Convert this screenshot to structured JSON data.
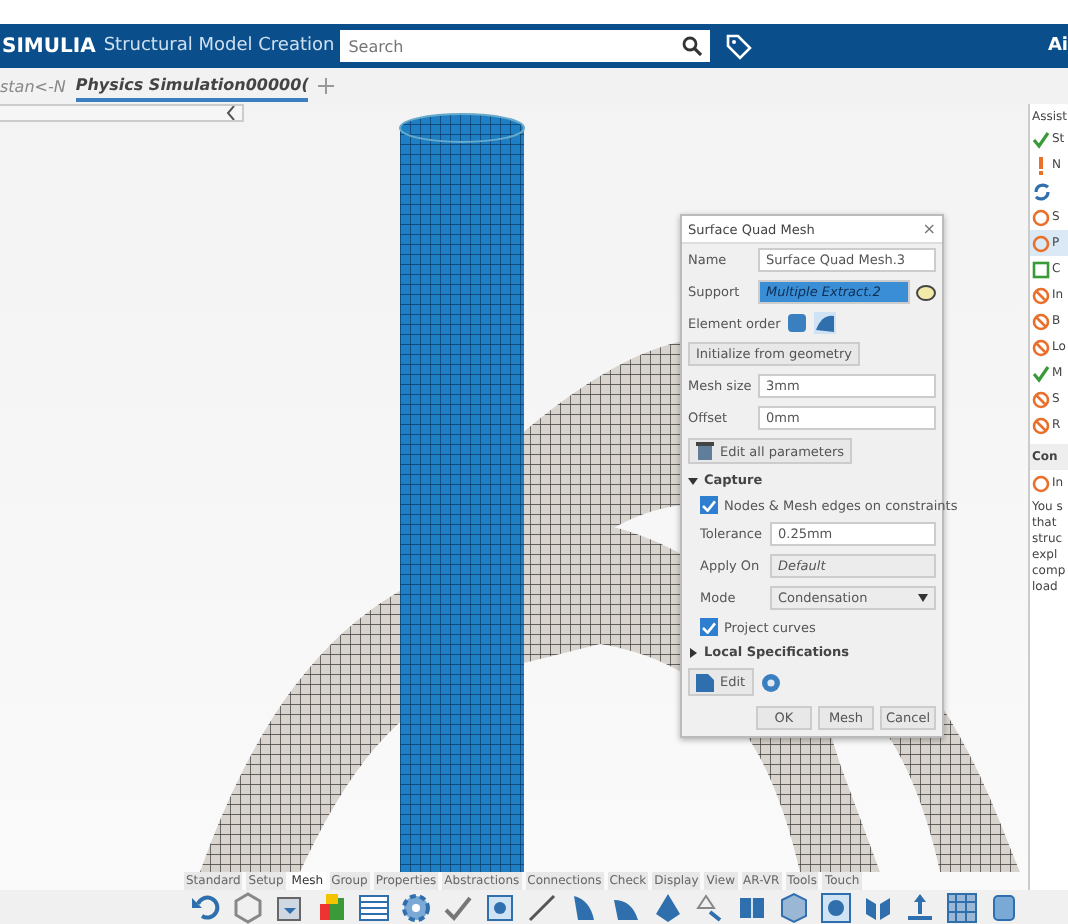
{
  "header": {
    "brand": "SIMULIA",
    "app_title": "Structural Model Creation",
    "search": {
      "placeholder": "Search"
    },
    "user_initials": "Ai"
  },
  "tabs": [
    {
      "label": "stan<-N",
      "selected": false
    },
    {
      "label": "Physics Simulation00000(",
      "selected": true
    }
  ],
  "dialog": {
    "title": "Surface Quad Mesh",
    "close": "×",
    "name_label": "Name",
    "name_value": "Surface Quad Mesh.3",
    "support_label": "Support",
    "support_value": "Multiple Extract.2",
    "element_order_label": "Element order",
    "init_button": "Initialize from geometry",
    "mesh_size_label": "Mesh size",
    "mesh_size_value": "3mm",
    "offset_label": "Offset",
    "offset_value": "0mm",
    "edit_all_button": "Edit all parameters",
    "capture": {
      "title": "Capture",
      "expanded": true,
      "nodes_label": "Nodes & Mesh edges on constraints",
      "nodes_checked": true,
      "tolerance_label": "Tolerance",
      "tolerance_value": "0.25mm",
      "apply_on_label": "Apply On",
      "apply_on_value": "Default",
      "mode_label": "Mode",
      "mode_value": "Condensation",
      "project_label": "Project curves",
      "project_checked": true
    },
    "local_specs": {
      "title": "Local Specifications",
      "expanded": false
    },
    "edit_button": "Edit",
    "buttons": [
      "OK",
      "Mesh",
      "Cancel"
    ]
  },
  "assistant": {
    "title": "Assist",
    "items": [
      {
        "kind": "done",
        "label": "St",
        "selected": false
      },
      {
        "kind": "warning",
        "label": "N",
        "selected": false
      },
      {
        "kind": "refresh",
        "selected": false
      },
      {
        "kind": "todo",
        "label": "S",
        "selected": false
      },
      {
        "kind": "todo",
        "label": "P",
        "selected": true
      },
      {
        "kind": "square",
        "label": "C",
        "selected": false
      },
      {
        "kind": "blocked",
        "label": "In",
        "selected": false
      },
      {
        "kind": "blocked",
        "label": "B",
        "selected": false
      },
      {
        "kind": "blocked",
        "label": "Lo",
        "selected": false
      },
      {
        "kind": "done",
        "label": "M",
        "selected": false
      },
      {
        "kind": "blocked",
        "label": "S",
        "selected": false
      },
      {
        "kind": "blocked",
        "label": "R",
        "selected": false
      }
    ],
    "section_title": "Con",
    "section_item": {
      "kind": "todo",
      "label": "In"
    },
    "description_lines": [
      "You s",
      "that",
      "struc",
      "expl",
      "comp",
      "load"
    ]
  },
  "toolbar_tabs": [
    {
      "label": "Standard",
      "selected": false
    },
    {
      "label": "Setup",
      "selected": false
    },
    {
      "label": "Mesh",
      "selected": true
    },
    {
      "label": "Group",
      "selected": false
    },
    {
      "label": "Properties",
      "selected": false
    },
    {
      "label": "Abstractions",
      "selected": false
    },
    {
      "label": "Connections",
      "selected": false
    },
    {
      "label": "Check",
      "selected": false
    },
    {
      "label": "Display",
      "selected": false
    },
    {
      "label": "View",
      "selected": false
    },
    {
      "label": "AR-VR",
      "selected": false
    },
    {
      "label": "Tools",
      "selected": false
    },
    {
      "label": "Touch",
      "selected": false
    }
  ]
}
